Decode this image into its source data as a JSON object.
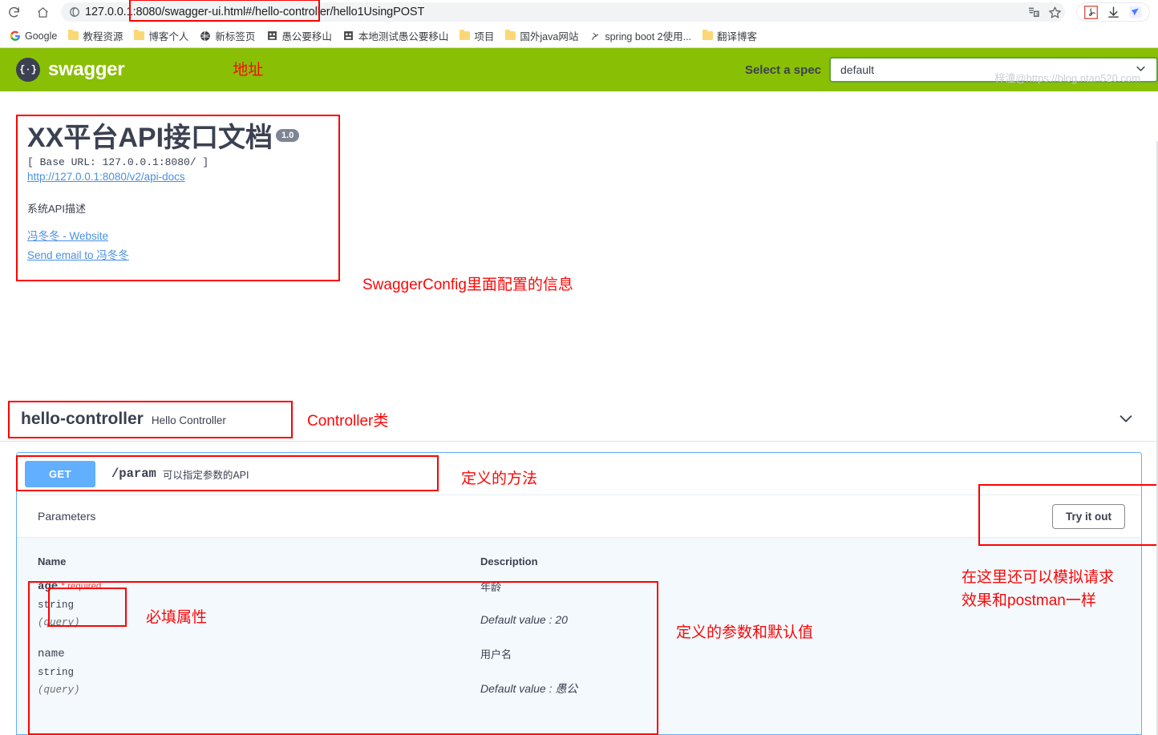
{
  "browser": {
    "reload_icon": "reload-icon",
    "home_icon": "home-icon",
    "site_info_icon": "site-info-icon",
    "url": "127.0.0.1:8080/swagger-ui.html#/hello-controller/hello1UsingPOST",
    "translate_icon": "translate-icon",
    "bookmark_star_icon": "star-icon",
    "pdf_icon": "pdf-extension-icon",
    "download_icon": "download-icon",
    "extension_icon": "extension-icon",
    "bookmarks": [
      {
        "label": "Google",
        "icon": "google-icon"
      },
      {
        "label": "教程资源",
        "icon": "folder-icon"
      },
      {
        "label": "博客个人",
        "icon": "folder-icon"
      },
      {
        "label": "新标签页",
        "icon": "globe-icon"
      },
      {
        "label": "愚公要移山",
        "icon": "site-icon"
      },
      {
        "label": "本地测试愚公要移山",
        "icon": "site-icon"
      },
      {
        "label": "项目",
        "icon": "folder-icon"
      },
      {
        "label": "国外java网站",
        "icon": "folder-icon"
      },
      {
        "label": "spring boot 2使用...",
        "icon": "site-icon"
      },
      {
        "label": "翻译博客",
        "icon": "folder-icon"
      }
    ]
  },
  "topbar": {
    "logo_text": "swagger",
    "logo_glyph": "{·}",
    "annotation_address": "地址",
    "select_spec_label": "Select a spec",
    "selected_spec": "default",
    "chevron_icon": "chevron-down-icon"
  },
  "info": {
    "title": "XX平台API接口文档",
    "version": "1.0",
    "base_url": "[ Base URL: 127.0.0.1:8080/ ]",
    "api_docs_link": "http://127.0.0.1:8080/v2/api-docs",
    "description": "系统API描述",
    "website_link": "冯冬冬 - Website",
    "email_link": "Send email to 冯冬冬",
    "annotation": "SwaggerConfig里面配置的信息"
  },
  "tag": {
    "name": "hello-controller",
    "description": "Hello Controller",
    "annotation": "Controller类",
    "chevron_icon": "chevron-down-icon"
  },
  "operation": {
    "method": "GET",
    "path": "/param",
    "summary": "可以指定参数的API",
    "annotation": "定义的方法",
    "parameters_title": "Parameters",
    "try_it_out": "Try it out",
    "annotation_try": "在这里还可以模拟请求",
    "annotation_try2": "效果和postman一样",
    "columns": {
      "name": "Name",
      "description": "Description"
    },
    "annotation_required": "必填属性",
    "annotation_defaults": "定义的参数和默认值",
    "rows": [
      {
        "name": "age",
        "required_star": "*",
        "required_label": "required",
        "type": "string",
        "in": "(query)",
        "description": "年龄",
        "default_label": "Default value",
        "default_value": "20"
      },
      {
        "name": "name",
        "required_star": "",
        "required_label": "",
        "type": "string",
        "in": "(query)",
        "description": "用户名",
        "default_label": "Default value",
        "default_value": "愚公"
      }
    ]
  },
  "watermark": "梓潼@https://blog.ntan520.com",
  "colors": {
    "swagger_green": "#89bf04",
    "get_blue": "#61affe",
    "annotation_red": "#fb0707",
    "link_blue": "#4990e2"
  }
}
